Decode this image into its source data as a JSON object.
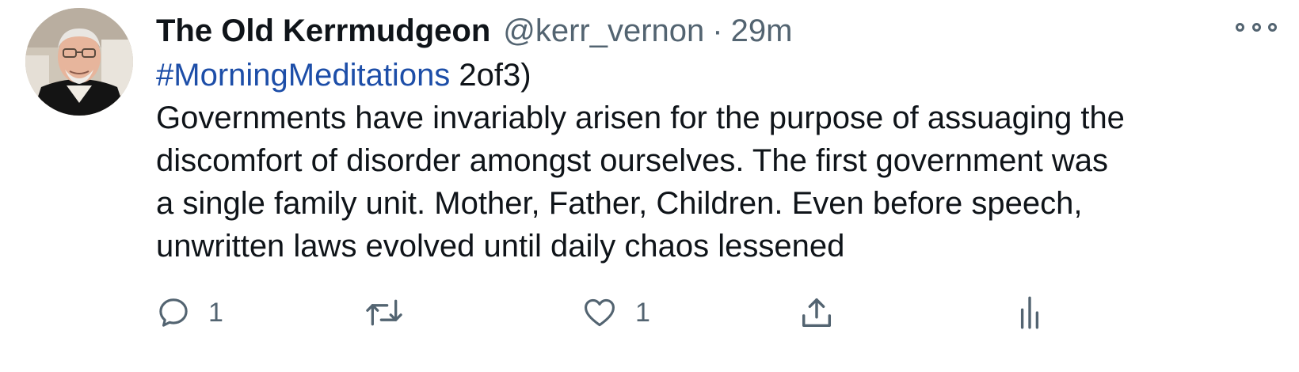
{
  "tweet": {
    "author": {
      "display_name": "The Old Kerrmudgeon",
      "handle": "@kerr_vernon",
      "separator": "·",
      "time": "29m"
    },
    "hashtag": "#MorningMeditations",
    "thread_marker": " 2of3)",
    "body_lines": [
      "Governments have invariably arisen for the purpose of assuaging the",
      "discomfort of disorder amongst ourselves. The first government was",
      "a single family unit. Mother, Father, Children. Even before speech,",
      "unwritten laws evolved until daily chaos lessened"
    ],
    "actions": {
      "reply_count": "1",
      "retweet_count": "",
      "like_count": "1"
    }
  },
  "icons": {
    "more": "more-horizontal-icon",
    "reply": "reply-icon",
    "retweet": "retweet-icon",
    "like": "heart-icon",
    "share": "share-icon",
    "analytics": "analytics-icon"
  },
  "colors": {
    "text": "#0f1419",
    "secondary": "#536471",
    "hashtag": "#1d4ea8"
  }
}
